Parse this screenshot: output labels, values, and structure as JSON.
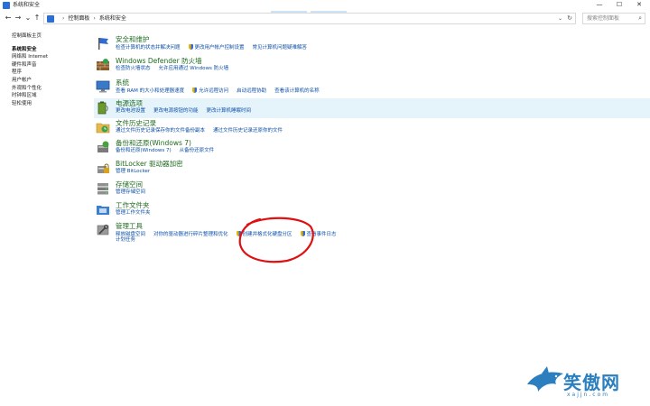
{
  "window": {
    "title": "系统和安全",
    "minimize": "—",
    "maximize": "☐",
    "close": "✕"
  },
  "nav": {
    "back": "←",
    "forward": "→",
    "down": "⌄",
    "up": "↑",
    "breadcrumb": [
      "控制面板",
      "系统和安全"
    ],
    "search_placeholder": "搜索控制面板"
  },
  "sidebar": {
    "items": [
      {
        "label": "控制面板主页",
        "current": false
      },
      {
        "label": "系统和安全",
        "current": true
      },
      {
        "label": "网络和 Internet",
        "current": false
      },
      {
        "label": "硬件和声音",
        "current": false
      },
      {
        "label": "程序",
        "current": false
      },
      {
        "label": "用户帐户",
        "current": false
      },
      {
        "label": "外观和个性化",
        "current": false
      },
      {
        "label": "时钟和区域",
        "current": false
      },
      {
        "label": "轻松使用",
        "current": false
      }
    ]
  },
  "categories": [
    {
      "title": "安全和维护",
      "icon": "flag-icon",
      "links": [
        "检查计算机的状态并解决问题",
        "更改用户帐户控制设置",
        "常见计算机问题疑难解答"
      ],
      "shield": [
        false,
        true,
        false
      ]
    },
    {
      "title": "Windows Defender 防火墙",
      "icon": "firewall-icon",
      "links": [
        "检查防火墙状态",
        "允许应用通过 Windows 防火墙"
      ],
      "shield": [
        false,
        false
      ]
    },
    {
      "title": "系统",
      "icon": "computer-icon",
      "links": [
        "查看 RAM 的大小和处理器速度",
        "允许远程访问",
        "启动远程协助",
        "查看该计算机的名称"
      ],
      "shield": [
        false,
        true,
        false,
        false
      ]
    },
    {
      "title": "电源选项",
      "icon": "battery-icon",
      "links": [
        "更改电池设置",
        "更改电源按钮的功能",
        "更改计算机睡眠时间"
      ],
      "shield": [
        false,
        false,
        false
      ]
    },
    {
      "title": "文件历史记录",
      "icon": "file-history-icon",
      "links": [
        "通过文件历史记录保存你的文件备份副本",
        "通过文件历史记录还原你的文件"
      ],
      "shield": [
        false,
        false
      ]
    },
    {
      "title": "备份和还原(Windows 7)",
      "icon": "backup-icon",
      "links": [
        "备份和还原(Windows 7)",
        "从备份还原文件"
      ],
      "shield": [
        false,
        false
      ]
    },
    {
      "title": "BitLocker 驱动器加密",
      "icon": "bitlocker-icon",
      "links": [
        "管理 BitLocker"
      ],
      "shield": [
        false
      ]
    },
    {
      "title": "存储空间",
      "icon": "storage-icon",
      "links": [
        "管理存储空间"
      ],
      "shield": [
        false
      ]
    },
    {
      "title": "工作文件夹",
      "icon": "work-folders-icon",
      "links": [
        "管理工作文件夹"
      ],
      "shield": [
        false
      ]
    },
    {
      "title": "管理工具",
      "icon": "admin-tools-icon",
      "links": [
        "释放磁盘空间",
        "对你的驱动器进行碎片整理和优化",
        "创建并格式化硬盘分区",
        "查看事件日志"
      ],
      "shield": [
        false,
        false,
        true,
        true
      ],
      "links2": [
        "计划任务"
      ],
      "shield2": [
        true
      ]
    }
  ],
  "watermark": {
    "text": "笑傲网",
    "sub": "xajjn.com"
  }
}
